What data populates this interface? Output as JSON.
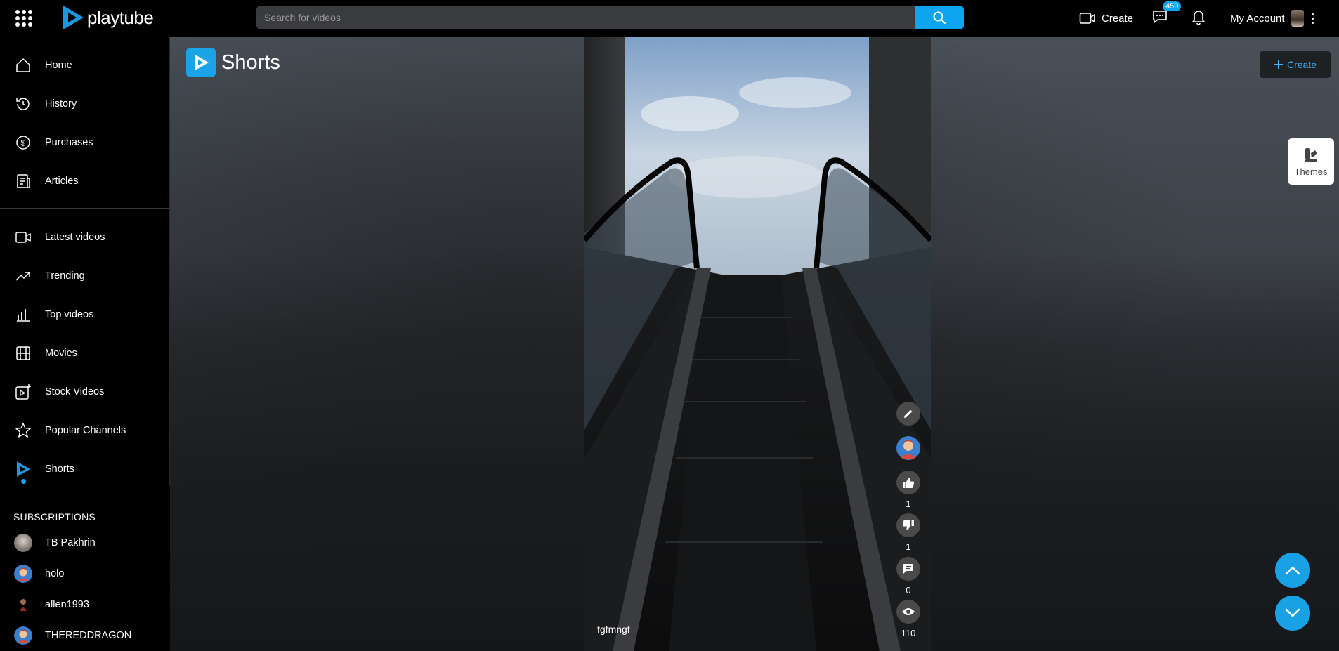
{
  "header": {
    "logo_text": "playtube",
    "search_placeholder": "Search for videos",
    "create_label": "Create",
    "messages_badge": "459",
    "account_label": "My Account"
  },
  "sidebar": {
    "items": [
      {
        "label": "Home",
        "icon": "home-icon"
      },
      {
        "label": "History",
        "icon": "history-icon"
      },
      {
        "label": "Purchases",
        "icon": "dollar-icon"
      },
      {
        "label": "Articles",
        "icon": "article-icon"
      }
    ],
    "items2": [
      {
        "label": "Latest videos",
        "icon": "video-camera-icon"
      },
      {
        "label": "Trending",
        "icon": "trending-icon"
      },
      {
        "label": "Top videos",
        "icon": "bar-chart-icon"
      },
      {
        "label": "Movies",
        "icon": "film-icon"
      },
      {
        "label": "Stock Videos",
        "icon": "stock-video-icon"
      },
      {
        "label": "Popular Channels",
        "icon": "star-icon"
      },
      {
        "label": "Shorts",
        "icon": "shorts-icon",
        "active": true
      }
    ],
    "subscriptions_title": "SUBSCRIPTIONS",
    "subscriptions": [
      {
        "name": "TB Pakhrin"
      },
      {
        "name": "holo"
      },
      {
        "name": "allen1993"
      },
      {
        "name": "THEREDDRAGON"
      }
    ]
  },
  "main": {
    "page_title": "Shorts",
    "create_label": "Create",
    "themes_label": "Themes"
  },
  "video": {
    "caption": "fgfmngf",
    "likes": "1",
    "dislikes": "1",
    "comments": "0",
    "views": "110"
  },
  "colors": {
    "accent": "#0ea5f0",
    "topbar": "#000000",
    "sidebar": "#000000"
  }
}
